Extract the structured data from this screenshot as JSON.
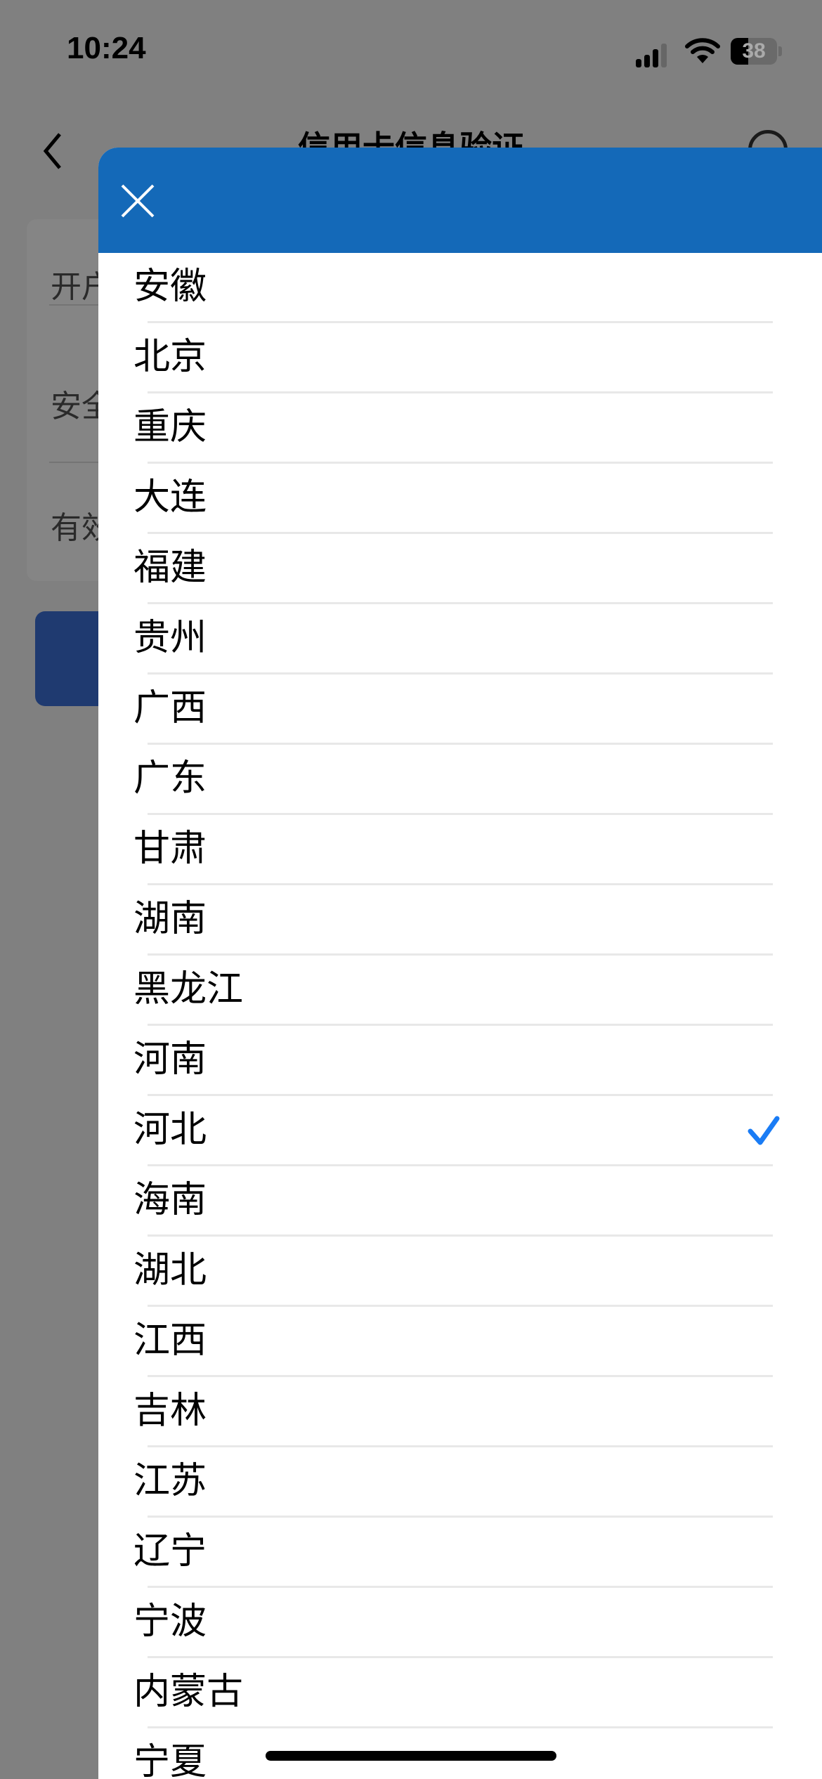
{
  "status_bar": {
    "time": "10:24",
    "battery": "38",
    "signal_icon": "cellular-signal-icon",
    "wifi_icon": "wifi-icon",
    "battery_icon": "battery-icon"
  },
  "background": {
    "nav": {
      "title": "信用卡信息验证",
      "back_icon": "back-chevron-icon",
      "search_icon": "search-icon"
    },
    "form_rows": [
      {
        "label": "开户"
      },
      {
        "label": "安全"
      },
      {
        "label": "有效"
      }
    ]
  },
  "picker": {
    "close_icon": "close-icon",
    "header_color": "#1469b8",
    "check_color": "#1a7cf5",
    "selected": "河北",
    "items": [
      {
        "label": "安徽",
        "selected": false
      },
      {
        "label": "北京",
        "selected": false
      },
      {
        "label": "重庆",
        "selected": false
      },
      {
        "label": "大连",
        "selected": false
      },
      {
        "label": "福建",
        "selected": false
      },
      {
        "label": "贵州",
        "selected": false
      },
      {
        "label": "广西",
        "selected": false
      },
      {
        "label": "广东",
        "selected": false
      },
      {
        "label": "甘肃",
        "selected": false
      },
      {
        "label": "湖南",
        "selected": false
      },
      {
        "label": "黑龙江",
        "selected": false
      },
      {
        "label": "河南",
        "selected": false
      },
      {
        "label": "河北",
        "selected": true
      },
      {
        "label": "海南",
        "selected": false
      },
      {
        "label": "湖北",
        "selected": false
      },
      {
        "label": "江西",
        "selected": false
      },
      {
        "label": "吉林",
        "selected": false
      },
      {
        "label": "江苏",
        "selected": false
      },
      {
        "label": "辽宁",
        "selected": false
      },
      {
        "label": "宁波",
        "selected": false
      },
      {
        "label": "内蒙古",
        "selected": false
      },
      {
        "label": "宁夏",
        "selected": false
      }
    ]
  }
}
